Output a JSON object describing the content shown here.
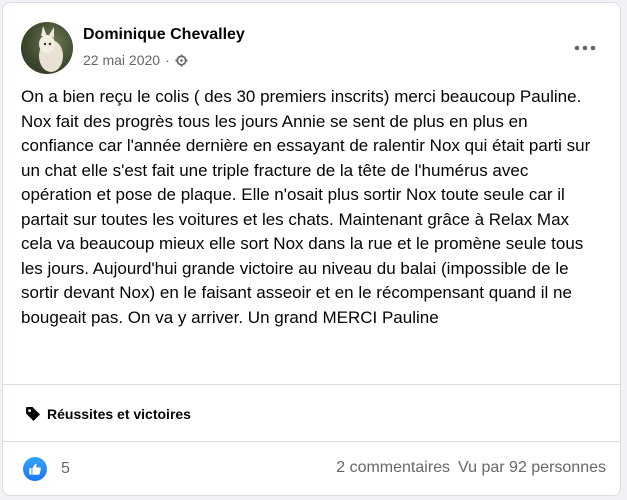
{
  "post": {
    "author": "Dominique Chevalley",
    "date": "22 mai 2020",
    "separator": "·",
    "privacy_icon": "gear-icon",
    "more_icon": "more-horizontal-icon",
    "paragraphs": [
      "On a bien reçu le colis ( des 30 premiers inscrits) merci beaucoup Pauline.",
      "Nox fait des progrès tous les jours Annie se sent de plus en plus en confiance car l'année dernière en essayant de ralentir Nox qui était parti sur un chat elle s'est fait une triple fracture de la tête de l'humérus avec opération et pose de plaque. Elle n'osait plus sortir Nox toute seule car il partait sur toutes les voitures et les chats. Maintenant  grâce à Relax Max cela va beaucoup mieux elle sort Nox dans la rue et le promène seule tous les jours. Aujourd'hui  grande victoire au niveau du balai (impossible de le sortir devant Nox) en le faisant asseoir et en le récompensant quand il ne bougeait pas. On va y arriver. Un grand MERCI Pauline"
    ]
  },
  "topic": {
    "icon": "tag-icon",
    "label": "Réussites et victoires"
  },
  "footer": {
    "reaction_icon": "like-icon",
    "reaction_count": "5",
    "comments": "2 commentaires",
    "views": "Vu par 92 personnes"
  },
  "colors": {
    "accent": "#1877f2",
    "text": "#050505",
    "muted": "#65676b",
    "divider": "#dadde1"
  }
}
